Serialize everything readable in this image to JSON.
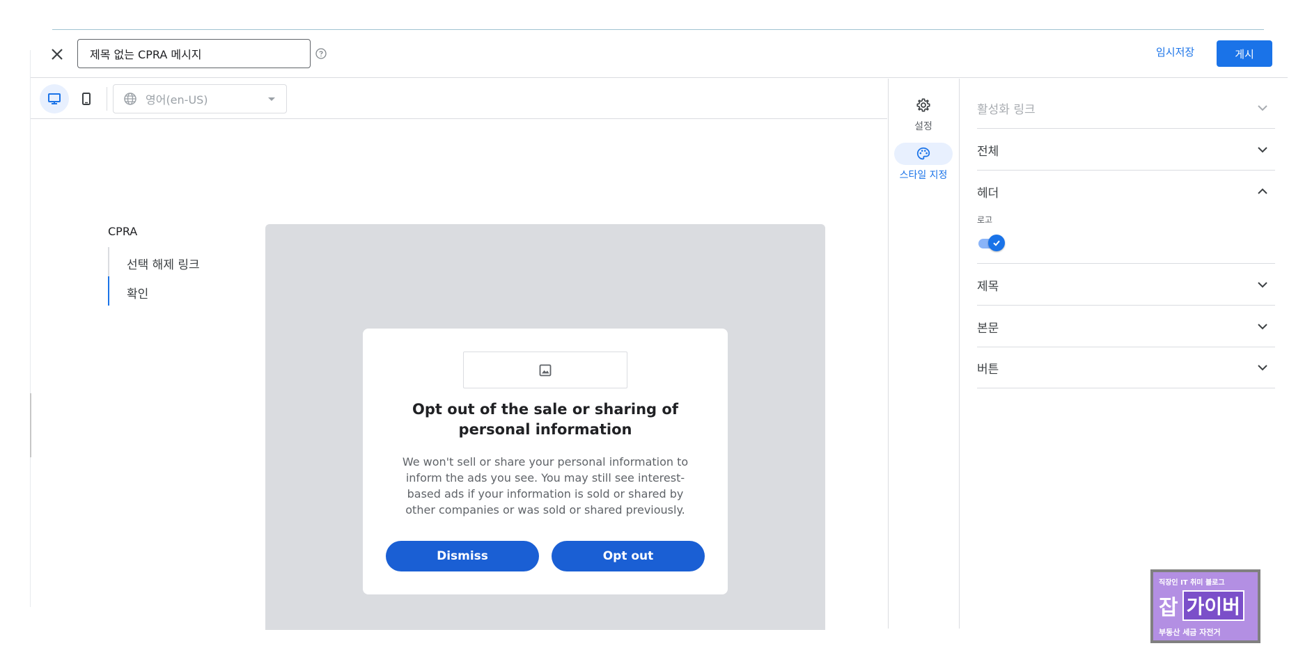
{
  "header": {
    "title_value": "제목 없는 CPRA 메시지",
    "draft_label": "임시저장",
    "publish_label": "게시"
  },
  "toolbar": {
    "language": "영어(en-US)"
  },
  "nav": {
    "title": "CPRA",
    "items": [
      {
        "label": "선택 해제 링크"
      },
      {
        "label": "확인"
      }
    ]
  },
  "dialog": {
    "title": "Opt out of the sale or sharing of personal information",
    "body": "We won't sell or share your personal information to inform the ads you see. You may still see interest-based ads if your information is sold or shared by other companies or was sold or shared previously.",
    "dismiss_label": "Dismiss",
    "optout_label": "Opt out"
  },
  "rail": {
    "settings_label": "설정",
    "style_label": "스타일 지정"
  },
  "panel": {
    "sections": [
      {
        "label": "활성화 링크"
      },
      {
        "label": "전체"
      },
      {
        "label": "헤더"
      },
      {
        "label": "제목"
      },
      {
        "label": "본문"
      },
      {
        "label": "버튼"
      }
    ],
    "logo_label": "로고",
    "logo_enabled": true
  },
  "watermark": {
    "top": "직장인 IT 취미 블로그",
    "big": "잡",
    "box": "가이버",
    "bottom": "부동산 세금 자전거"
  },
  "colors": {
    "accent": "#1a73e8",
    "dialog_button": "#1a5fd4",
    "canvas": "#dadce0"
  }
}
